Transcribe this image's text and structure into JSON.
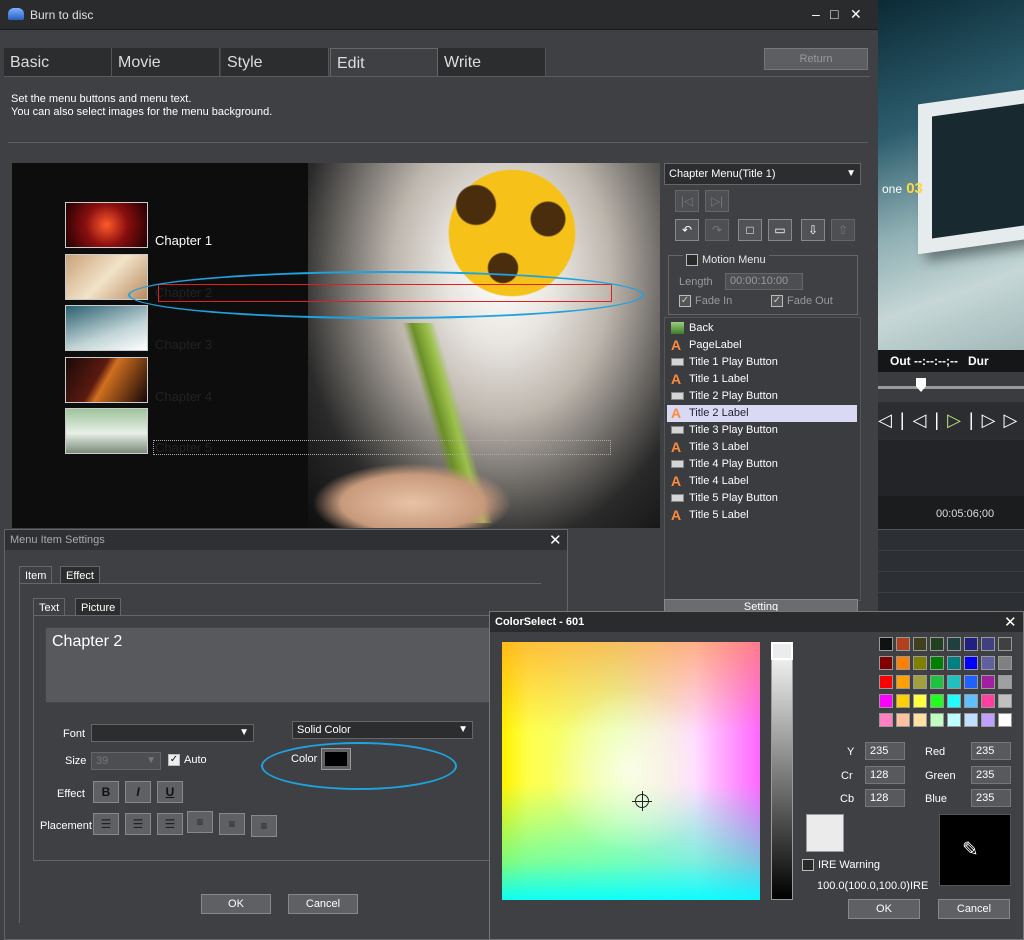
{
  "window": {
    "title": "Burn to disc",
    "minimize": "–",
    "maximize": "□",
    "close": "✕"
  },
  "tabs": [
    {
      "label": "Basic"
    },
    {
      "label": "Movie"
    },
    {
      "label": "Style"
    },
    {
      "label": "Edit",
      "active": true
    },
    {
      "label": "Write"
    }
  ],
  "return_label": "Return",
  "description": {
    "line1": "Set the menu buttons and menu text.",
    "line2": "You can also select images for the menu background."
  },
  "preview": {
    "chapters": [
      {
        "label": "Chapter 1"
      },
      {
        "label": "Chapter 2"
      },
      {
        "label": "Chapter 3"
      },
      {
        "label": "Chapter 4"
      },
      {
        "label": "Chapter 5"
      }
    ]
  },
  "right_panel": {
    "menu_select": "Chapter Menu(Title 1)",
    "motion_menu_label": "Motion Menu",
    "length_label": "Length",
    "length_value": "00:00:10:00",
    "fade_in": "Fade In",
    "fade_out": "Fade Out",
    "setting_label": "Setting",
    "tree": [
      {
        "label": "Back",
        "type": "image"
      },
      {
        "label": "PageLabel",
        "type": "label"
      },
      {
        "label": "Title 1 Play Button",
        "type": "button"
      },
      {
        "label": "Title 1 Label",
        "type": "label"
      },
      {
        "label": "Title 2 Play Button",
        "type": "button"
      },
      {
        "label": "Title 2 Label",
        "type": "label",
        "selected": true
      },
      {
        "label": "Title 3 Play Button",
        "type": "button"
      },
      {
        "label": "Title 3 Label",
        "type": "label"
      },
      {
        "label": "Title 4 Play Button",
        "type": "button"
      },
      {
        "label": "Title 4 Label",
        "type": "label"
      },
      {
        "label": "Title 5 Play Button",
        "type": "button"
      },
      {
        "label": "Title 5 Label",
        "type": "label"
      }
    ]
  },
  "menu_item_settings": {
    "title": "Menu Item Settings",
    "tab_item": "Item",
    "tab_effect": "Effect",
    "subtab_text": "Text",
    "subtab_picture": "Picture",
    "text_value": "Chapter 2",
    "font_label": "Font",
    "font_value": "",
    "size_label": "Size",
    "size_value": "39",
    "auto_label": "Auto",
    "fill_type": "Solid Color",
    "color_label": "Color",
    "effect_label": "Effect",
    "bold": "B",
    "italic": "I",
    "underline": "U",
    "placement_label": "Placement",
    "ok_label": "OK",
    "cancel_label": "Cancel"
  },
  "color_select": {
    "title": "ColorSelect - 601",
    "y_label": "Y",
    "y_value": "235",
    "cr_label": "Cr",
    "cr_value": "128",
    "cb_label": "Cb",
    "cb_value": "128",
    "red_label": "Red",
    "red_value": "235",
    "green_label": "Green",
    "green_value": "235",
    "blue_label": "Blue",
    "blue_value": "235",
    "ire_warning_label": "IRE Warning",
    "ire_value": "100.0(100.0,100.0)IRE",
    "ok_label": "OK",
    "cancel_label": "Cancel",
    "swatches": [
      "#111111",
      "#b04020",
      "#404020",
      "#204020",
      "#204040",
      "#202080",
      "#404080",
      "#404040",
      "#800000",
      "#ff8000",
      "#808000",
      "#008000",
      "#008080",
      "#0000ff",
      "#6060a0",
      "#808080",
      "#ff0000",
      "#ffa000",
      "#a0a040",
      "#20c040",
      "#20c0c0",
      "#2060ff",
      "#a020a0",
      "#a0a0a0",
      "#ff00ff",
      "#ffd000",
      "#ffff40",
      "#20ff20",
      "#20ffff",
      "#60c0ff",
      "#ff40a0",
      "#c0c0c0",
      "#ff80c0",
      "#ffc0a0",
      "#ffe0a0",
      "#c0ffc0",
      "#c0ffff",
      "#c0e0ff",
      "#c0a0ff",
      "#ffffff"
    ]
  },
  "background_player": {
    "chapter_prefix": "one",
    "chapter_number": "03",
    "out_label": "Out",
    "out_value": "--:--:--;--",
    "dur_label": "Dur",
    "ruler_time": "00:05:06;00"
  }
}
